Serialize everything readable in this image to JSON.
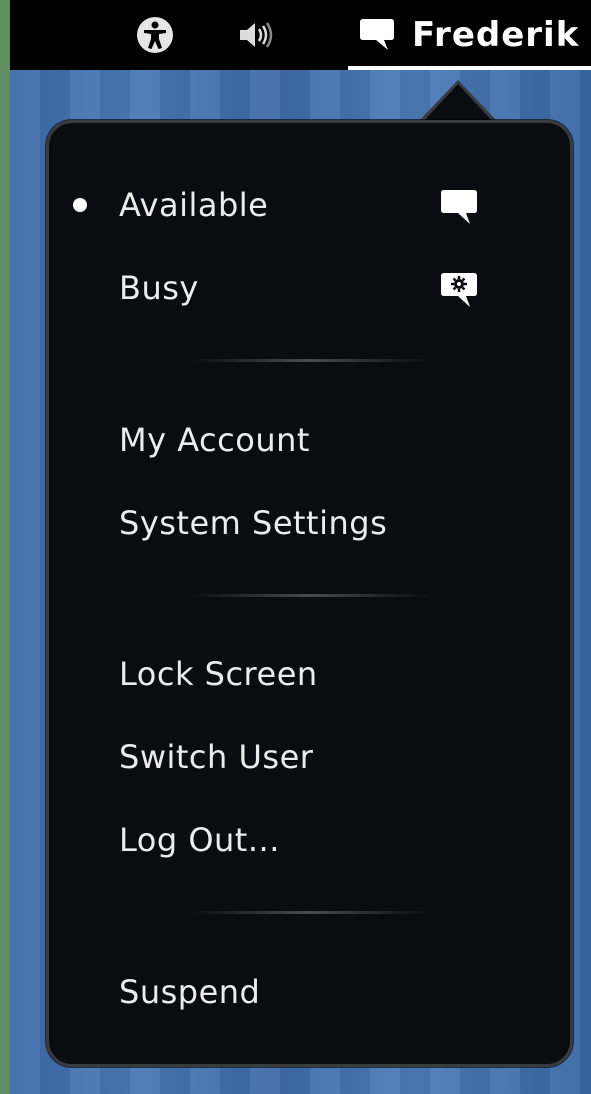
{
  "topbar": {
    "accessibility_icon": "accessibility-icon",
    "volume_icon": "volume-icon",
    "user_icon": "chat-bubble-icon",
    "user_name": "Frederik"
  },
  "menu": {
    "status": [
      {
        "label": "Available",
        "icon": "chat-bubble-icon",
        "selected": true
      },
      {
        "label": "Busy",
        "icon": "chat-bubble-busy-icon",
        "selected": false
      }
    ],
    "account": [
      {
        "label": "My Account"
      },
      {
        "label": "System Settings"
      }
    ],
    "session": [
      {
        "label": "Lock Screen"
      },
      {
        "label": "Switch User"
      },
      {
        "label": "Log Out..."
      }
    ],
    "power": [
      {
        "label": "Suspend"
      }
    ]
  },
  "colors": {
    "menu_bg": "#0b0c12",
    "menu_border": "#3a3b40",
    "text": "#ececec",
    "topbar_bg": "#000000",
    "desktop": "#4a78b6"
  }
}
